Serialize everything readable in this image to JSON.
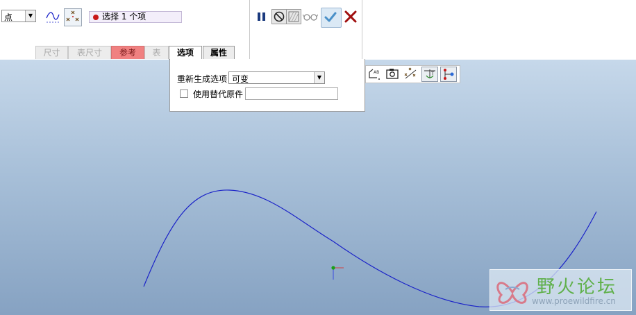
{
  "dashboard": {
    "type_select": {
      "value": "点"
    },
    "collector": {
      "text": "选择 1 个项"
    },
    "tabs": [
      {
        "label": "尺寸",
        "state": "disabled"
      },
      {
        "label": "表尺寸",
        "state": "disabled"
      },
      {
        "label": "参考",
        "state": "required"
      },
      {
        "label": "表",
        "state": "disabled"
      },
      {
        "label": "选项",
        "state": "active"
      },
      {
        "label": "属性",
        "state": "normal"
      }
    ],
    "controls": {
      "pause_icon": "pause-icon",
      "no_entry_icon": "no-entry-icon",
      "datum_icon": "datum-preview-icon",
      "glasses_icon": "glasses-icon",
      "ok_icon": "checkmark-icon",
      "cancel_icon": "x-icon"
    },
    "colors": {
      "ok": "#4a90c8",
      "cancel": "#a01010",
      "pause": "#1b3a7e",
      "required_tab": "#f08080"
    }
  },
  "options_panel": {
    "regen_label": "重新生成选项",
    "regen_value": "可变",
    "substitute_label": "使用替代原件",
    "substitute_checked": false,
    "substitute_value": ""
  },
  "mini_toolbar": {
    "icons": [
      "copy-text-icon",
      "camera-icon",
      "points-x-icon",
      "anchor-icon",
      "points-link-icon"
    ]
  },
  "viewport": {
    "curve_color": "#1a22c8"
  },
  "watermark": {
    "title": "野火论坛",
    "url": "www.proewildfire.cn"
  }
}
